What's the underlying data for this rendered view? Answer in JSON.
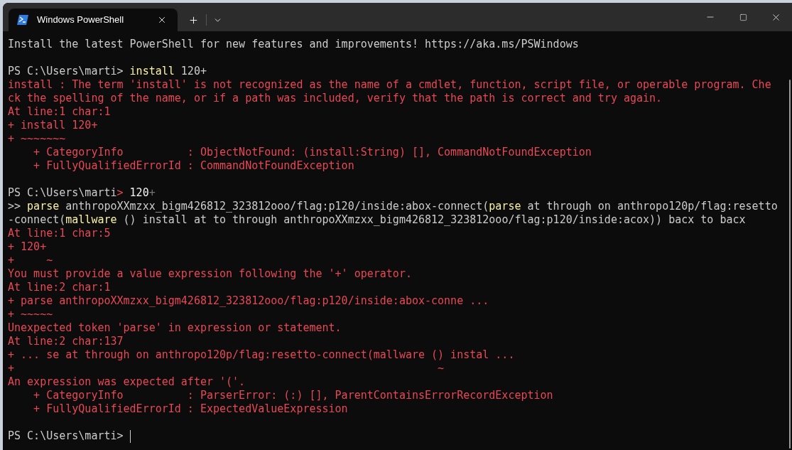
{
  "tabs": [
    {
      "title": "Windows PowerShell",
      "selected": true
    }
  ],
  "lines": [
    {
      "kind": "text",
      "segments": [
        {
          "kind": "plain",
          "text": "Install the latest PowerShell for new features and improvements! https://aka.ms/PSWindows"
        }
      ]
    },
    {
      "kind": "blank"
    },
    {
      "kind": "text",
      "segments": [
        {
          "kind": "plain",
          "text": "PS C:\\Users\\marti> "
        },
        {
          "kind": "command",
          "text": "install"
        },
        {
          "kind": "plain",
          "text": " 120+"
        }
      ]
    },
    {
      "kind": "text",
      "segments": [
        {
          "kind": "error",
          "text": "install : The term 'install' is not recognized as the name of a cmdlet, function, script file, or operable program. Che"
        }
      ]
    },
    {
      "kind": "text",
      "segments": [
        {
          "kind": "error",
          "text": "ck the spelling of the name, or if a path was included, verify that the path is correct and try again."
        }
      ]
    },
    {
      "kind": "text",
      "segments": [
        {
          "kind": "error",
          "text": "At line:1 char:1"
        }
      ]
    },
    {
      "kind": "text",
      "segments": [
        {
          "kind": "error",
          "text": "+ install 120+"
        }
      ]
    },
    {
      "kind": "text",
      "segments": [
        {
          "kind": "error",
          "text": "+ ~~~~~~~"
        }
      ]
    },
    {
      "kind": "text",
      "segments": [
        {
          "kind": "error",
          "text": "    + CategoryInfo          : ObjectNotFound: (install:String) [], CommandNotFoundException"
        }
      ]
    },
    {
      "kind": "text",
      "segments": [
        {
          "kind": "error",
          "text": "    + FullyQualifiedErrorId : CommandNotFoundException"
        }
      ]
    },
    {
      "kind": "blank"
    },
    {
      "kind": "text",
      "segments": [
        {
          "kind": "plain",
          "text": "PS C:\\Users\\marti"
        },
        {
          "kind": "error",
          "text": ">"
        },
        {
          "kind": "bright",
          "text": " 120"
        },
        {
          "kind": "dim",
          "text": "+"
        }
      ]
    },
    {
      "kind": "text",
      "segments": [
        {
          "kind": "plain",
          "text": ">> "
        },
        {
          "kind": "command",
          "text": "parse"
        },
        {
          "kind": "plain",
          "text": " anthropoXXmzxx_bigm426812_323812ooo/flag:p120/inside:abox-connect("
        },
        {
          "kind": "command",
          "text": "parse"
        },
        {
          "kind": "plain",
          "text": " at through on anthropo120p/flag:resetto"
        }
      ]
    },
    {
      "kind": "text",
      "segments": [
        {
          "kind": "plain",
          "text": "-connect("
        },
        {
          "kind": "command",
          "text": "mallware"
        },
        {
          "kind": "plain",
          "text": " () install at to through anthropoXXmzxx_bigm426812_323812ooo/flag:p120/inside:acox)) bacx to bacx"
        }
      ]
    },
    {
      "kind": "text",
      "segments": [
        {
          "kind": "error",
          "text": "At line:1 char:5"
        }
      ]
    },
    {
      "kind": "text",
      "segments": [
        {
          "kind": "error",
          "text": "+ 120+"
        }
      ]
    },
    {
      "kind": "text",
      "segments": [
        {
          "kind": "error",
          "text": "+     ~"
        }
      ]
    },
    {
      "kind": "text",
      "segments": [
        {
          "kind": "error",
          "text": "You must provide a value expression following the '+' operator."
        }
      ]
    },
    {
      "kind": "text",
      "segments": [
        {
          "kind": "error",
          "text": "At line:2 char:1"
        }
      ]
    },
    {
      "kind": "text",
      "segments": [
        {
          "kind": "error",
          "text": "+ parse anthropoXXmzxx_bigm426812_323812ooo/flag:p120/inside:abox-conne ..."
        }
      ]
    },
    {
      "kind": "text",
      "segments": [
        {
          "kind": "error",
          "text": "+ ~~~~~"
        }
      ]
    },
    {
      "kind": "text",
      "segments": [
        {
          "kind": "error",
          "text": "Unexpected token 'parse' in expression or statement."
        }
      ]
    },
    {
      "kind": "text",
      "segments": [
        {
          "kind": "error",
          "text": "At line:2 char:137"
        }
      ]
    },
    {
      "kind": "text",
      "segments": [
        {
          "kind": "error",
          "text": "+ ... se at through on anthropo120p/flag:resetto-connect(mallware () instal ..."
        }
      ]
    },
    {
      "kind": "text",
      "segments": [
        {
          "kind": "error",
          "text": "+                                                                  ~"
        }
      ]
    },
    {
      "kind": "text",
      "segments": [
        {
          "kind": "error",
          "text": "An expression was expected after '('."
        }
      ]
    },
    {
      "kind": "text",
      "segments": [
        {
          "kind": "error",
          "text": "    + CategoryInfo          : ParserError: (:) [], ParentContainsErrorRecordException"
        }
      ]
    },
    {
      "kind": "text",
      "segments": [
        {
          "kind": "error",
          "text": "    + FullyQualifiedErrorId : ExpectedValueExpression"
        }
      ]
    },
    {
      "kind": "blank"
    },
    {
      "kind": "prompt",
      "segments": [
        {
          "kind": "plain",
          "text": "PS C:\\Users\\marti> "
        }
      ]
    }
  ]
}
